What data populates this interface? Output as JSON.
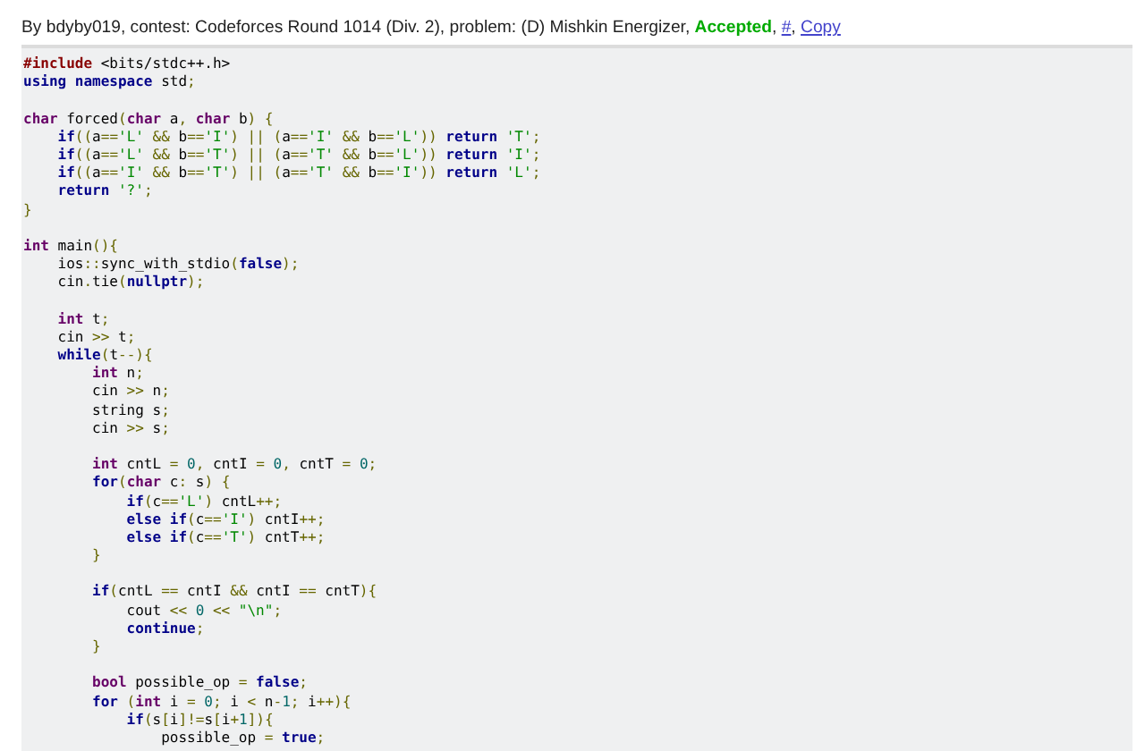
{
  "header": [
    {
      "kind": "plain",
      "text": "By bdyby019, contest: Codeforces Round 1014 (Div. 2), problem: (D) Mishkin Energizer, "
    },
    {
      "kind": "verdict",
      "text": "Accepted"
    },
    {
      "kind": "plain",
      "text": ", "
    },
    {
      "kind": "link",
      "text": "#"
    },
    {
      "kind": "plain",
      "text": ", "
    },
    {
      "kind": "link",
      "text": "Copy"
    }
  ],
  "code_blocks": [
    {
      "lines": [
        {
          "tokens": [
            {
              "kind": "directive",
              "text": "#include"
            },
            {
              "kind": "plain",
              "text": " <bits/stdc++.h>"
            }
          ]
        },
        {
          "tokens": [
            {
              "kind": "kw",
              "text": "using namespace"
            },
            {
              "kind": "plain",
              "text": " std"
            },
            {
              "kind": "punct",
              "text": ";"
            }
          ]
        }
      ]
    },
    {
      "lines": [
        {
          "tokens": [
            {
              "kind": "type",
              "text": "char"
            },
            {
              "kind": "plain",
              "text": " forced"
            },
            {
              "kind": "punct",
              "text": "("
            },
            {
              "kind": "type",
              "text": "char"
            },
            {
              "kind": "plain",
              "text": " a"
            },
            {
              "kind": "punct",
              "text": ","
            },
            {
              "kind": "type",
              "text": " char"
            },
            {
              "kind": "plain",
              "text": " b"
            },
            {
              "kind": "punct",
              "text": ")"
            },
            {
              "kind": "punct",
              "text": " {"
            }
          ]
        },
        {
          "tokens": [
            {
              "kind": "kw",
              "text": "    if"
            },
            {
              "kind": "punct",
              "text": "(("
            },
            {
              "kind": "plain",
              "text": "a"
            },
            {
              "kind": "punct",
              "text": "=="
            },
            {
              "kind": "str",
              "text": "'L'"
            },
            {
              "kind": "punct",
              "text": " &&"
            },
            {
              "kind": "plain",
              "text": " b"
            },
            {
              "kind": "punct",
              "text": "=="
            },
            {
              "kind": "str",
              "text": "'I'"
            },
            {
              "kind": "punct",
              "text": ")"
            },
            {
              "kind": "punct",
              "text": " ||"
            },
            {
              "kind": "punct",
              "text": " ("
            },
            {
              "kind": "plain",
              "text": "a"
            },
            {
              "kind": "punct",
              "text": "=="
            },
            {
              "kind": "str",
              "text": "'I'"
            },
            {
              "kind": "punct",
              "text": " &&"
            },
            {
              "kind": "plain",
              "text": " b"
            },
            {
              "kind": "punct",
              "text": "=="
            },
            {
              "kind": "str",
              "text": "'L'"
            },
            {
              "kind": "punct",
              "text": "))"
            },
            {
              "kind": "kw",
              "text": " return"
            },
            {
              "kind": "str",
              "text": " 'T'"
            },
            {
              "kind": "punct",
              "text": ";"
            }
          ]
        },
        {
          "tokens": [
            {
              "kind": "kw",
              "text": "    if"
            },
            {
              "kind": "punct",
              "text": "(("
            },
            {
              "kind": "plain",
              "text": "a"
            },
            {
              "kind": "punct",
              "text": "=="
            },
            {
              "kind": "str",
              "text": "'L'"
            },
            {
              "kind": "punct",
              "text": " &&"
            },
            {
              "kind": "plain",
              "text": " b"
            },
            {
              "kind": "punct",
              "text": "=="
            },
            {
              "kind": "str",
              "text": "'T'"
            },
            {
              "kind": "punct",
              "text": ")"
            },
            {
              "kind": "punct",
              "text": " ||"
            },
            {
              "kind": "punct",
              "text": " ("
            },
            {
              "kind": "plain",
              "text": "a"
            },
            {
              "kind": "punct",
              "text": "=="
            },
            {
              "kind": "str",
              "text": "'T'"
            },
            {
              "kind": "punct",
              "text": " &&"
            },
            {
              "kind": "plain",
              "text": " b"
            },
            {
              "kind": "punct",
              "text": "=="
            },
            {
              "kind": "str",
              "text": "'L'"
            },
            {
              "kind": "punct",
              "text": "))"
            },
            {
              "kind": "kw",
              "text": " return"
            },
            {
              "kind": "str",
              "text": " 'I'"
            },
            {
              "kind": "punct",
              "text": ";"
            }
          ]
        },
        {
          "tokens": [
            {
              "kind": "kw",
              "text": "    if"
            },
            {
              "kind": "punct",
              "text": "(("
            },
            {
              "kind": "plain",
              "text": "a"
            },
            {
              "kind": "punct",
              "text": "=="
            },
            {
              "kind": "str",
              "text": "'I'"
            },
            {
              "kind": "punct",
              "text": " &&"
            },
            {
              "kind": "plain",
              "text": " b"
            },
            {
              "kind": "punct",
              "text": "=="
            },
            {
              "kind": "str",
              "text": "'T'"
            },
            {
              "kind": "punct",
              "text": ")"
            },
            {
              "kind": "punct",
              "text": " ||"
            },
            {
              "kind": "punct",
              "text": " ("
            },
            {
              "kind": "plain",
              "text": "a"
            },
            {
              "kind": "punct",
              "text": "=="
            },
            {
              "kind": "str",
              "text": "'T'"
            },
            {
              "kind": "punct",
              "text": " &&"
            },
            {
              "kind": "plain",
              "text": " b"
            },
            {
              "kind": "punct",
              "text": "=="
            },
            {
              "kind": "str",
              "text": "'I'"
            },
            {
              "kind": "punct",
              "text": "))"
            },
            {
              "kind": "kw",
              "text": " return"
            },
            {
              "kind": "str",
              "text": " 'L'"
            },
            {
              "kind": "punct",
              "text": ";"
            }
          ]
        },
        {
          "tokens": [
            {
              "kind": "kw",
              "text": "    return"
            },
            {
              "kind": "str",
              "text": " '?'"
            },
            {
              "kind": "punct",
              "text": ";"
            }
          ]
        },
        {
          "tokens": [
            {
              "kind": "punct",
              "text": "}"
            }
          ]
        }
      ]
    },
    {
      "lines": [
        {
          "tokens": [
            {
              "kind": "type",
              "text": "int"
            },
            {
              "kind": "plain",
              "text": " main"
            },
            {
              "kind": "punct",
              "text": "(){"
            }
          ]
        },
        {
          "tokens": [
            {
              "kind": "plain",
              "text": "    ios"
            },
            {
              "kind": "punct",
              "text": "::"
            },
            {
              "kind": "plain",
              "text": "sync_with_stdio"
            },
            {
              "kind": "punct",
              "text": "("
            },
            {
              "kind": "kw",
              "text": "false"
            },
            {
              "kind": "punct",
              "text": ");"
            }
          ]
        },
        {
          "tokens": [
            {
              "kind": "plain",
              "text": "    cin"
            },
            {
              "kind": "punct",
              "text": "."
            },
            {
              "kind": "plain",
              "text": "tie"
            },
            {
              "kind": "punct",
              "text": "("
            },
            {
              "kind": "kw",
              "text": "nullptr"
            },
            {
              "kind": "punct",
              "text": ");"
            }
          ]
        }
      ]
    },
    {
      "lines": [
        {
          "tokens": [
            {
              "kind": "type",
              "text": "    int"
            },
            {
              "kind": "plain",
              "text": " t"
            },
            {
              "kind": "punct",
              "text": ";"
            }
          ]
        },
        {
          "tokens": [
            {
              "kind": "plain",
              "text": "    cin"
            },
            {
              "kind": "punct",
              "text": " >>"
            },
            {
              "kind": "plain",
              "text": " t"
            },
            {
              "kind": "punct",
              "text": ";"
            }
          ]
        },
        {
          "tokens": [
            {
              "kind": "kw",
              "text": "    while"
            },
            {
              "kind": "punct",
              "text": "("
            },
            {
              "kind": "plain",
              "text": "t"
            },
            {
              "kind": "punct",
              "text": "--){"
            }
          ]
        },
        {
          "tokens": [
            {
              "kind": "type",
              "text": "        int"
            },
            {
              "kind": "plain",
              "text": " n"
            },
            {
              "kind": "punct",
              "text": ";"
            }
          ]
        },
        {
          "tokens": [
            {
              "kind": "plain",
              "text": "        cin"
            },
            {
              "kind": "punct",
              "text": " >>"
            },
            {
              "kind": "plain",
              "text": " n"
            },
            {
              "kind": "punct",
              "text": ";"
            }
          ]
        },
        {
          "tokens": [
            {
              "kind": "plain",
              "text": "        string s"
            },
            {
              "kind": "punct",
              "text": ";"
            }
          ]
        },
        {
          "tokens": [
            {
              "kind": "plain",
              "text": "        cin"
            },
            {
              "kind": "punct",
              "text": " >>"
            },
            {
              "kind": "plain",
              "text": " s"
            },
            {
              "kind": "punct",
              "text": ";"
            }
          ]
        }
      ]
    },
    {
      "lines": [
        {
          "tokens": [
            {
              "kind": "type",
              "text": "        int"
            },
            {
              "kind": "plain",
              "text": " cntL"
            },
            {
              "kind": "punct",
              "text": " ="
            },
            {
              "kind": "num",
              "text": " 0"
            },
            {
              "kind": "punct",
              "text": ","
            },
            {
              "kind": "plain",
              "text": " cntI"
            },
            {
              "kind": "punct",
              "text": " ="
            },
            {
              "kind": "num",
              "text": " 0"
            },
            {
              "kind": "punct",
              "text": ","
            },
            {
              "kind": "plain",
              "text": " cntT"
            },
            {
              "kind": "punct",
              "text": " ="
            },
            {
              "kind": "num",
              "text": " 0"
            },
            {
              "kind": "punct",
              "text": ";"
            }
          ]
        },
        {
          "tokens": [
            {
              "kind": "kw",
              "text": "        for"
            },
            {
              "kind": "punct",
              "text": "("
            },
            {
              "kind": "type",
              "text": "char"
            },
            {
              "kind": "plain",
              "text": " c"
            },
            {
              "kind": "punct",
              "text": ":"
            },
            {
              "kind": "plain",
              "text": " s"
            },
            {
              "kind": "punct",
              "text": ")"
            },
            {
              "kind": "punct",
              "text": " {"
            }
          ]
        },
        {
          "tokens": [
            {
              "kind": "kw",
              "text": "            if"
            },
            {
              "kind": "punct",
              "text": "("
            },
            {
              "kind": "plain",
              "text": "c"
            },
            {
              "kind": "punct",
              "text": "=="
            },
            {
              "kind": "str",
              "text": "'L'"
            },
            {
              "kind": "punct",
              "text": ")"
            },
            {
              "kind": "plain",
              "text": " cntL"
            },
            {
              "kind": "punct",
              "text": "++;"
            }
          ]
        },
        {
          "tokens": [
            {
              "kind": "kw",
              "text": "            else if"
            },
            {
              "kind": "punct",
              "text": "("
            },
            {
              "kind": "plain",
              "text": "c"
            },
            {
              "kind": "punct",
              "text": "=="
            },
            {
              "kind": "str",
              "text": "'I'"
            },
            {
              "kind": "punct",
              "text": ")"
            },
            {
              "kind": "plain",
              "text": " cntI"
            },
            {
              "kind": "punct",
              "text": "++;"
            }
          ]
        },
        {
          "tokens": [
            {
              "kind": "kw",
              "text": "            else if"
            },
            {
              "kind": "punct",
              "text": "("
            },
            {
              "kind": "plain",
              "text": "c"
            },
            {
              "kind": "punct",
              "text": "=="
            },
            {
              "kind": "str",
              "text": "'T'"
            },
            {
              "kind": "punct",
              "text": ")"
            },
            {
              "kind": "plain",
              "text": " cntT"
            },
            {
              "kind": "punct",
              "text": "++;"
            }
          ]
        },
        {
          "tokens": [
            {
              "kind": "punct",
              "text": "        }"
            }
          ]
        }
      ]
    },
    {
      "lines": [
        {
          "tokens": [
            {
              "kind": "kw",
              "text": "        if"
            },
            {
              "kind": "punct",
              "text": "("
            },
            {
              "kind": "plain",
              "text": "cntL"
            },
            {
              "kind": "punct",
              "text": " =="
            },
            {
              "kind": "plain",
              "text": " cntI"
            },
            {
              "kind": "punct",
              "text": " &&"
            },
            {
              "kind": "plain",
              "text": " cntI"
            },
            {
              "kind": "punct",
              "text": " =="
            },
            {
              "kind": "plain",
              "text": " cntT"
            },
            {
              "kind": "punct",
              "text": "){"
            }
          ]
        },
        {
          "tokens": [
            {
              "kind": "plain",
              "text": "            cout"
            },
            {
              "kind": "punct",
              "text": " <<"
            },
            {
              "kind": "num",
              "text": " 0"
            },
            {
              "kind": "punct",
              "text": " <<"
            },
            {
              "kind": "str",
              "text": " \"\\n\""
            },
            {
              "kind": "punct",
              "text": ";"
            }
          ]
        },
        {
          "tokens": [
            {
              "kind": "kw",
              "text": "            continue"
            },
            {
              "kind": "punct",
              "text": ";"
            }
          ]
        },
        {
          "tokens": [
            {
              "kind": "punct",
              "text": "        }"
            }
          ]
        }
      ]
    },
    {
      "lines": [
        {
          "tokens": [
            {
              "kind": "type",
              "text": "        bool"
            },
            {
              "kind": "plain",
              "text": " possible_op"
            },
            {
              "kind": "punct",
              "text": " ="
            },
            {
              "kind": "kw",
              "text": " false"
            },
            {
              "kind": "punct",
              "text": ";"
            }
          ]
        },
        {
          "tokens": [
            {
              "kind": "kw",
              "text": "        for"
            },
            {
              "kind": "punct",
              "text": " ("
            },
            {
              "kind": "type",
              "text": "int"
            },
            {
              "kind": "plain",
              "text": " i"
            },
            {
              "kind": "punct",
              "text": " ="
            },
            {
              "kind": "num",
              "text": " 0"
            },
            {
              "kind": "punct",
              "text": ";"
            },
            {
              "kind": "plain",
              "text": " i"
            },
            {
              "kind": "punct",
              "text": " <"
            },
            {
              "kind": "plain",
              "text": " n"
            },
            {
              "kind": "punct",
              "text": "-"
            },
            {
              "kind": "num",
              "text": "1"
            },
            {
              "kind": "punct",
              "text": ";"
            },
            {
              "kind": "plain",
              "text": " i"
            },
            {
              "kind": "punct",
              "text": "++){"
            }
          ]
        },
        {
          "tokens": [
            {
              "kind": "kw",
              "text": "            if"
            },
            {
              "kind": "punct",
              "text": "("
            },
            {
              "kind": "plain",
              "text": "s"
            },
            {
              "kind": "punct",
              "text": "["
            },
            {
              "kind": "plain",
              "text": "i"
            },
            {
              "kind": "punct",
              "text": "]!="
            },
            {
              "kind": "plain",
              "text": "s"
            },
            {
              "kind": "punct",
              "text": "["
            },
            {
              "kind": "plain",
              "text": "i"
            },
            {
              "kind": "punct",
              "text": "+"
            },
            {
              "kind": "num",
              "text": "1"
            },
            {
              "kind": "punct",
              "text": "]){"
            }
          ]
        },
        {
          "tokens": [
            {
              "kind": "plain",
              "text": "                possible_op"
            },
            {
              "kind": "punct",
              "text": " ="
            },
            {
              "kind": "kw",
              "text": " true"
            },
            {
              "kind": "punct",
              "text": ";"
            }
          ]
        }
      ]
    }
  ]
}
